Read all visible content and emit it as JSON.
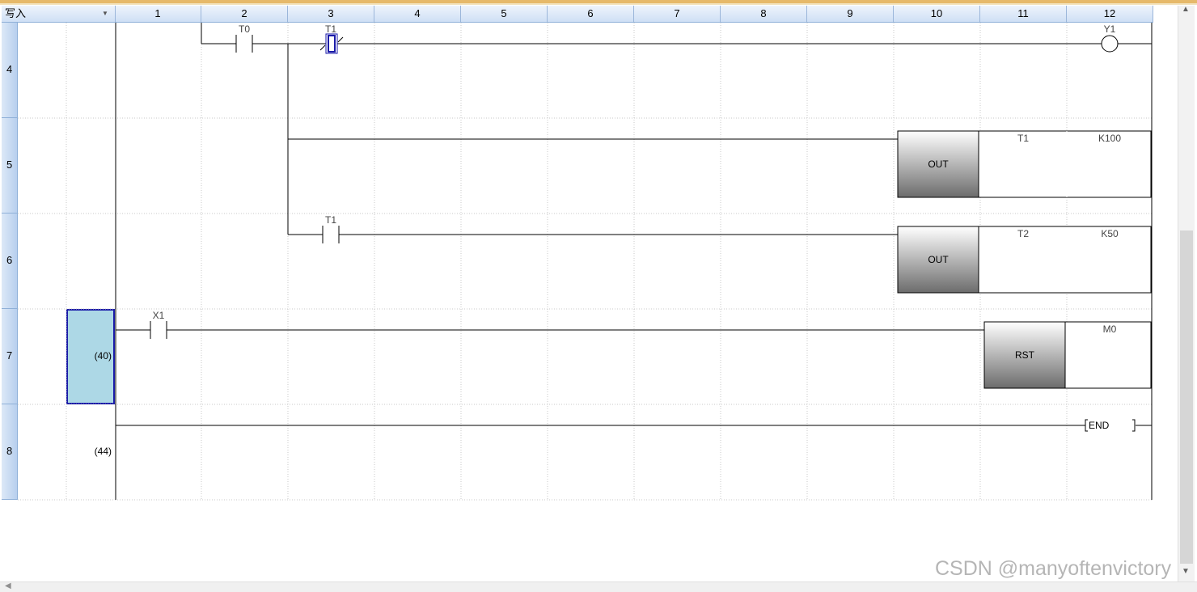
{
  "header": {
    "mode_label": "写入",
    "mode_dropdown_icon": "chevron-down-icon",
    "columns": [
      "1",
      "2",
      "3",
      "4",
      "5",
      "6",
      "7",
      "8",
      "9",
      "10",
      "11",
      "12"
    ]
  },
  "rows": [
    {
      "number": "4",
      "step": ""
    },
    {
      "number": "5",
      "step": ""
    },
    {
      "number": "6",
      "step": ""
    },
    {
      "number": "7",
      "step": "(40)"
    },
    {
      "number": "8",
      "step": "(44)"
    }
  ],
  "ladder": {
    "contact_t0": "T0",
    "contact_t1_top": "T1",
    "coil_y1": "Y1",
    "out1": {
      "instruction": "OUT",
      "device": "T1",
      "value": "K100"
    },
    "contact_t1_mid": "T1",
    "out2": {
      "instruction": "OUT",
      "device": "T2",
      "value": "K50"
    },
    "contact_x1": "X1",
    "rst": {
      "instruction": "RST",
      "device": "M0"
    },
    "end": "END"
  },
  "scrollbar": {
    "up_icon": "arrow-up-icon",
    "down_icon": "arrow-down-icon",
    "left_icon": "arrow-left-icon"
  },
  "watermark": "CSDN @manyoftenvictory",
  "colors": {
    "header_bg": "#cfe0f5",
    "row_header": "#b7cfee",
    "selection": "#add8e6",
    "selection_border": "#1a1aa8",
    "top_accent": "#e6b96a"
  }
}
